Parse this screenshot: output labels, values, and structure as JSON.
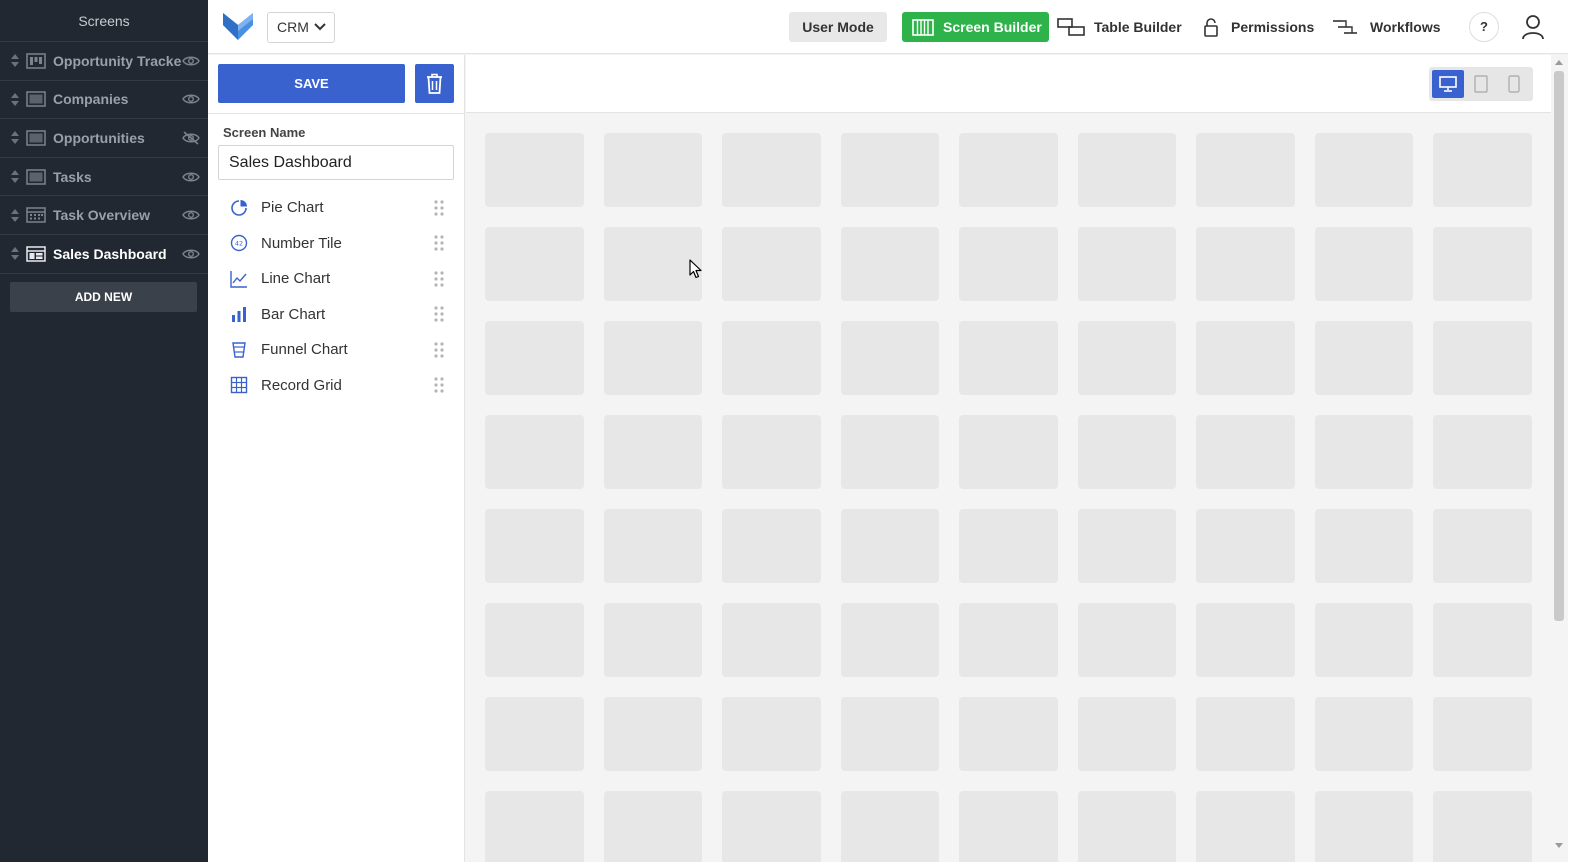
{
  "sidebar": {
    "title": "Screens",
    "items": [
      {
        "label": "Opportunity Tracker",
        "icon": "kanban-icon",
        "visibility": "visible"
      },
      {
        "label": "Companies",
        "icon": "table-icon",
        "visibility": "visible"
      },
      {
        "label": "Opportunities",
        "icon": "table-icon",
        "visibility": "hidden"
      },
      {
        "label": "Tasks",
        "icon": "table-icon",
        "visibility": "visible"
      },
      {
        "label": "Task Overview",
        "icon": "calendar-icon",
        "visibility": "visible"
      },
      {
        "label": "Sales Dashboard",
        "icon": "dashboard-icon",
        "visibility": "visible",
        "active": true
      }
    ],
    "add_new_label": "ADD NEW"
  },
  "topbar": {
    "app_select_value": "CRM",
    "user_mode_label": "User Mode",
    "screen_builder_label": "Screen Builder",
    "table_builder_label": "Table Builder",
    "permissions_label": "Permissions",
    "workflows_label": "Workflows",
    "help_label": "?"
  },
  "panel": {
    "save_label": "SAVE",
    "screen_name_label": "Screen Name",
    "screen_name_value": "Sales Dashboard",
    "widgets": [
      {
        "label": "Pie Chart",
        "icon": "pie-chart-icon"
      },
      {
        "label": "Number Tile",
        "icon": "number-tile-icon"
      },
      {
        "label": "Line Chart",
        "icon": "line-chart-icon"
      },
      {
        "label": "Bar Chart",
        "icon": "bar-chart-icon"
      },
      {
        "label": "Funnel Chart",
        "icon": "funnel-chart-icon"
      },
      {
        "label": "Record Grid",
        "icon": "record-grid-icon"
      }
    ]
  },
  "canvas": {
    "device_modes": [
      "desktop",
      "tablet",
      "mobile"
    ],
    "selected_device": "desktop",
    "grid_columns": 9,
    "grid_rows_visible": 8
  },
  "colors": {
    "sidebar_bg": "#222831",
    "accent_blue": "#3a62cf",
    "screen_builder_green": "#2db34a",
    "grid_cell": "#e7e7e7"
  }
}
